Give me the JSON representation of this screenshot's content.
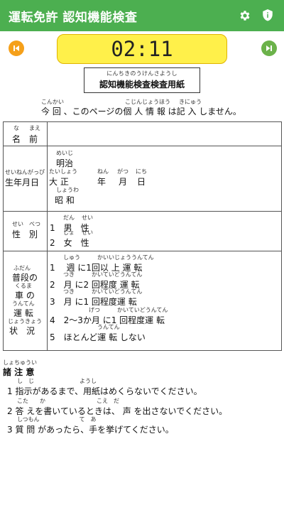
{
  "appbar": {
    "title": "運転免許 認知機能検査",
    "settings_icon": "gear-icon",
    "info_icon": "shield-info-icon",
    "color": "#4caf50"
  },
  "timer": {
    "value": "02:11",
    "color": "#fff04a"
  },
  "nav": {
    "prev_icon": "skip-previous-icon",
    "next_icon": "skip-next-icon",
    "prev_color": "#f5a01a",
    "next_color": "#6bb24a"
  },
  "doc": {
    "title_ruby": "にんちきのうけんさようし",
    "title": "認知機能検査検査用紙",
    "notice": "今 回 、このページの個 人 情 報 は記 入 しません。",
    "notice_ruby": {
      "konkai": "こんかい",
      "kojinjouhou": "こじんじょうほう",
      "kinyuu": "きにゅう"
    }
  },
  "form": {
    "name": {
      "label": "名　前",
      "ruby_na": "な",
      "ruby_mae": "まえ"
    },
    "birthday": {
      "label": "生年月日",
      "ruby": "せいねんがっぴ",
      "era_meiji": "明治",
      "ruby_meiji": "めいじ",
      "era_taisho": "大 正",
      "ruby_taisho": "たいしょう",
      "era_showa": "昭 和",
      "ruby_showa": "しょうわ",
      "year": "年",
      "month": "月",
      "day": "日",
      "ruby_nen": "ねん",
      "ruby_gatsu": "がつ",
      "ruby_nichi": "にち"
    },
    "gender": {
      "label": "性　別",
      "ruby_sei": "せい",
      "ruby_betsu": "べつ",
      "options": [
        "1　男　性",
        "2　女　性"
      ],
      "ruby_dan": "だん",
      "ruby_jo": "じょ",
      "ruby_sei2": "せい"
    },
    "driving": {
      "label_lines": [
        "普段の",
        "車 の",
        "運 転",
        "状　況"
      ],
      "label_ruby": [
        "ふだん",
        "くるま",
        "うんてん",
        "じょうきょう"
      ],
      "options": [
        "1　 週 に1回以 上 運 転",
        "2　月 に2 回程度 運 転",
        "3　月 に1 回程度運 転",
        "4　2～3か月 に1 回程度運 転",
        "5　ほとんど運 転 しない"
      ],
      "options_ruby": [
        "しゅう　　　かいいじょううんてん",
        "つき　　　かいていどうんてん",
        "つき　　　かいていどうんてん",
        "げつ　　　かいていどうんてん",
        "うんてん"
      ]
    }
  },
  "notes": {
    "heading": "諸 注 意",
    "heading_ruby": "しょちゅうい",
    "items": [
      "1 指示があるまで、用紙はめくらないでください。",
      "2 答 えを書いているときは、 声 を出さないでください。",
      "3 質 問 があったら、手を挙げてください。"
    ],
    "items_ruby": [
      "し　じ　　　　　　　　ようし",
      "こた　　か　　　　　　　　　こえ　だ",
      "しつもん　　　　　　　て　あ"
    ]
  }
}
